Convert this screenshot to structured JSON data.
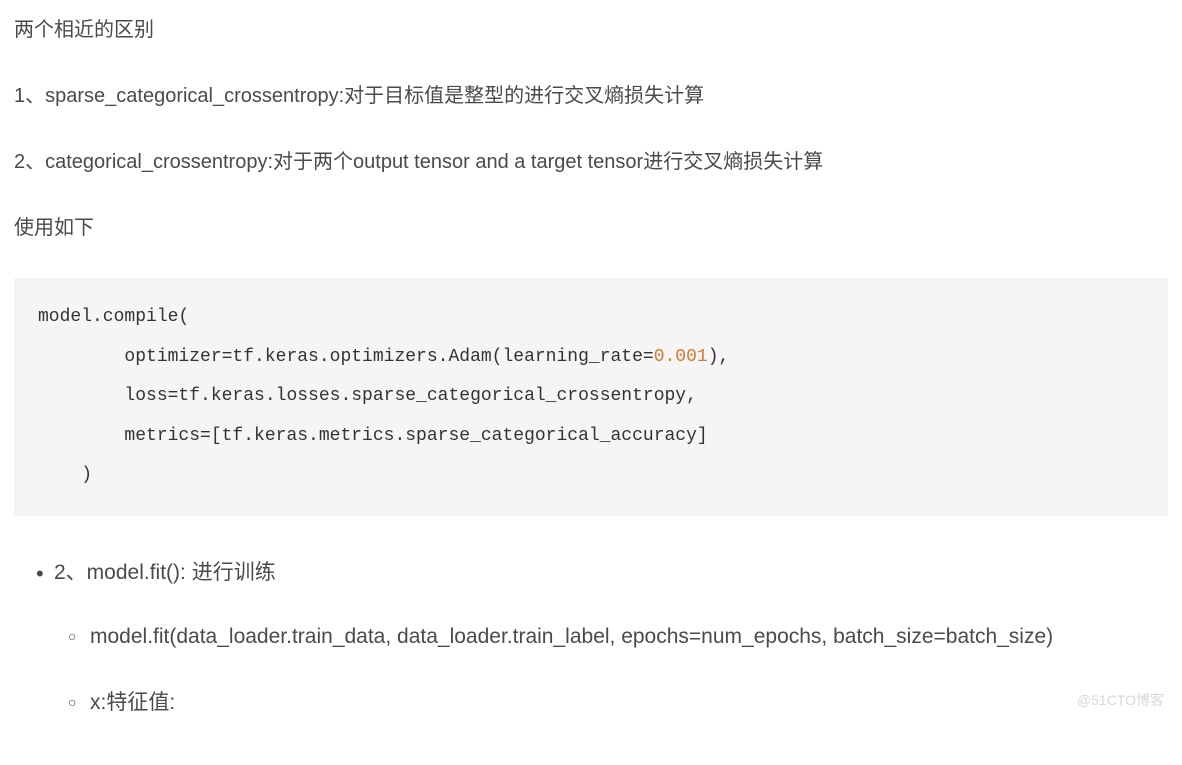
{
  "paragraphs": {
    "p1": "两个相近的区别",
    "p2": "1、sparse_categorical_crossentropy:对于目标值是整型的进行交叉熵损失计算",
    "p3": "2、categorical_crossentropy:对于两个output tensor and a target tensor进行交叉熵损失计算",
    "p4": "使用如下"
  },
  "code": {
    "line1": "model.compile(",
    "line2_pre": "        optimizer=tf.keras.optimizers.Adam(learning_rate=",
    "line2_num": "0.001",
    "line2_post": "),",
    "line3": "        loss=tf.keras.losses.sparse_categorical_crossentropy,",
    "line4": "        metrics=[tf.keras.metrics.sparse_categorical_accuracy]",
    "line5": "    )"
  },
  "bullets": {
    "item1": "2、model.fit():  进行训练",
    "sub1": "model.fit(data_loader.train_data, data_loader.train_label, epochs=num_epochs, batch_size=batch_size)",
    "sub2": "x:特征值:"
  },
  "watermark": "@51CTO博客"
}
